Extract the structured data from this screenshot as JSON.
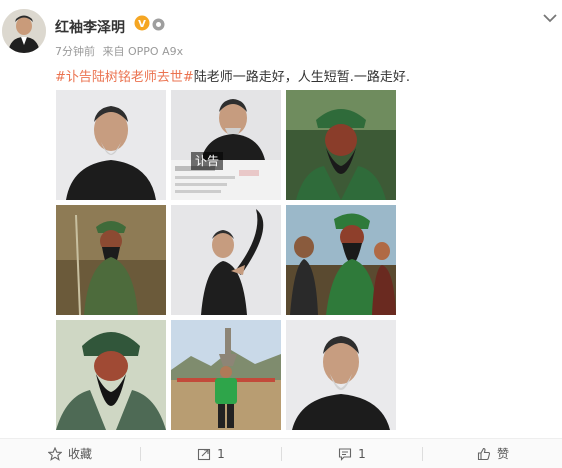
{
  "post": {
    "username": "红袖李泽明",
    "time": "7分钟前",
    "source": "来自 OPPO A9x",
    "hashtag": "#讣告陆树铭老师去世#",
    "text": "陆老师一路走好，人生短暂.一路走好."
  },
  "images": [
    {
      "name": "portrait-1"
    },
    {
      "name": "obituary-screenshot",
      "stamp": "讣告"
    },
    {
      "name": "guan-yu-still-1"
    },
    {
      "name": "guan-yu-still-2"
    },
    {
      "name": "sword-pose"
    },
    {
      "name": "group-still"
    },
    {
      "name": "guan-yu-closeup"
    },
    {
      "name": "outdoor-monument"
    },
    {
      "name": "portrait-2"
    }
  ],
  "actions": {
    "favorite": "收藏",
    "repost_count": "1",
    "comment_count": "1",
    "like": "赞"
  },
  "colors": {
    "hashtag": "#eb7350",
    "vip": "#f5a623"
  },
  "icons": [
    "star-icon",
    "repost-icon",
    "comment-icon",
    "like-icon",
    "chevron-down-icon"
  ]
}
